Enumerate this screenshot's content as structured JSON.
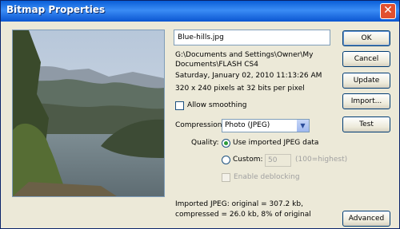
{
  "window": {
    "title": "Bitmap Properties",
    "close_icon": "close-icon"
  },
  "image": {
    "name": "Blue-hills.jpg"
  },
  "info": {
    "path_line1": "G:\\Documents and Settings\\Owner\\My",
    "path_line2": "Documents\\FLASH CS4",
    "date": "Saturday, January 02, 2010  11:13:26 AM",
    "dimensions": "320 x 240 pixels at 32 bits per pixel"
  },
  "options": {
    "allow_smoothing": "Allow smoothing",
    "compression_label": "Compression:",
    "compression_value": "Photo (JPEG)",
    "quality_label": "Quality:",
    "use_imported": "Use imported JPEG data",
    "custom": "Custom:",
    "custom_value": "50",
    "custom_hint": "(100=highest)",
    "enable_deblocking": "Enable deblocking"
  },
  "summary": {
    "line1": "Imported JPEG: original = 307.2 kb,",
    "line2": "compressed = 26.0 kb, 8% of original"
  },
  "buttons": {
    "ok": "OK",
    "cancel": "Cancel",
    "update": "Update",
    "import": "Import...",
    "test": "Test",
    "advanced": "Advanced"
  }
}
